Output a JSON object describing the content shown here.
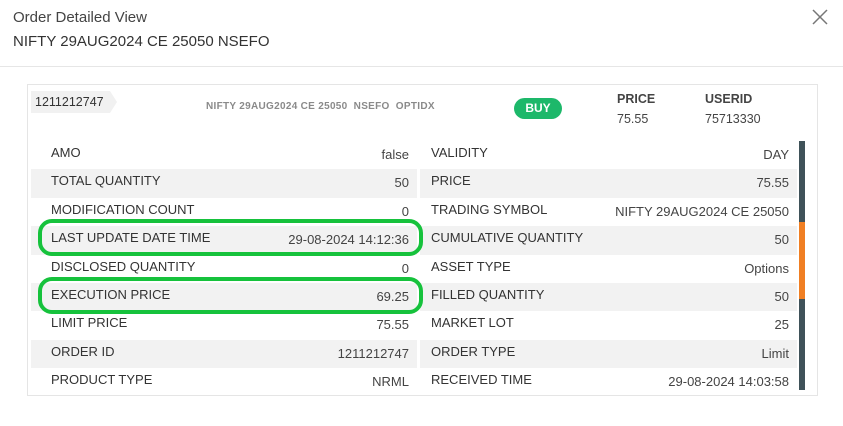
{
  "header": {
    "title": "Order Detailed View",
    "subtitle": "NIFTY 29AUG2024 CE 25050 NSEFO"
  },
  "summary": {
    "order_id": "1211212747",
    "symbol_line": "NIFTY 29AUG2024 CE 25050  NSEFO  OPTIDX",
    "side": "BUY",
    "price_label": "PRICE",
    "price_value": "75.55",
    "userid_label": "USERID",
    "userid_value": "75713330"
  },
  "rows": [
    {
      "left_key": "AMO",
      "left_val": "false",
      "right_key": "VALIDITY",
      "right_val": "DAY"
    },
    {
      "left_key": "TOTAL QUANTITY",
      "left_val": "50",
      "right_key": "PRICE",
      "right_val": "75.55"
    },
    {
      "left_key": "MODIFICATION COUNT",
      "left_val": "0",
      "right_key": "TRADING SYMBOL",
      "right_val": "NIFTY 29AUG2024 CE 25050"
    },
    {
      "left_key": "LAST UPDATE DATE TIME",
      "left_val": "29-08-2024 14:12:36",
      "right_key": "CUMULATIVE QUANTITY",
      "right_val": "50"
    },
    {
      "left_key": "DISCLOSED QUANTITY",
      "left_val": "0",
      "right_key": "ASSET TYPE",
      "right_val": "Options"
    },
    {
      "left_key": "EXECUTION PRICE",
      "left_val": "69.25",
      "right_key": "FILLED QUANTITY",
      "right_val": "50"
    },
    {
      "left_key": "LIMIT PRICE",
      "left_val": "75.55",
      "right_key": "MARKET LOT",
      "right_val": "25"
    },
    {
      "left_key": "ORDER ID",
      "left_val": "1211212747",
      "right_key": "ORDER TYPE",
      "right_val": "Limit"
    },
    {
      "left_key": "PRODUCT TYPE",
      "left_val": "NRML",
      "right_key": "RECEIVED TIME",
      "right_val": "29-08-2024 14:03:58"
    }
  ],
  "colors": {
    "buy_green": "#1db86a",
    "highlight_green": "#16c23c",
    "bar_dark": "#3f5259",
    "bar_orange": "#f07f23"
  }
}
